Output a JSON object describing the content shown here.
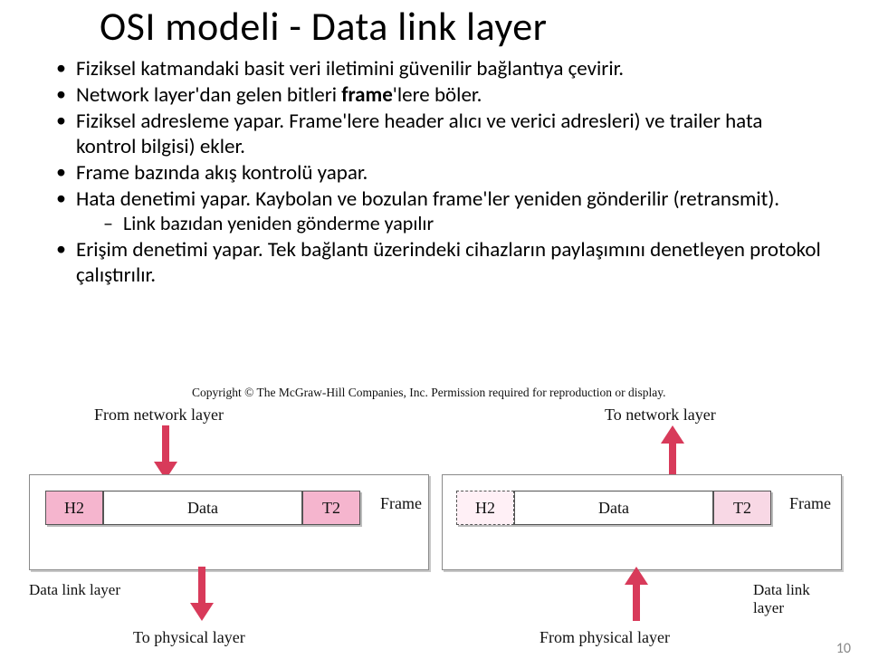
{
  "title": "OSI modeli - Data link layer",
  "bullets": [
    {
      "text": "Fiziksel katmandaki basit veri iletimini güvenilir bağlantıya çevirir."
    },
    {
      "pre": "Network layer'dan gelen bitleri ",
      "bold": "frame",
      "post": "'lere böler."
    },
    {
      "text": "Fiziksel adresleme yapar. Frame'lere header alıcı ve verici adresleri) ve trailer hata kontrol bilgisi) ekler."
    },
    {
      "text": "Frame bazında akış kontrolü yapar."
    },
    {
      "text": "Hata denetimi yapar. Kaybolan ve bozulan frame'ler yeniden gönderilir (retransmit)."
    },
    {
      "sub": "Link bazıdan yeniden gönderme yapılır"
    },
    {
      "text": "Erişim denetimi yapar. Tek bağlantı üzerindeki cihazların paylaşımını denetleyen protokol çalıştırılır."
    }
  ],
  "diagram": {
    "copyright": "Copyright © The McGraw-Hill Companies, Inc. Permission required for reproduction or display.",
    "from_network": "From network layer",
    "to_network": "To network layer",
    "frame_label": "Frame",
    "dll_label": "Data link layer",
    "to_physical": "To physical layer",
    "from_physical": "From physical layer",
    "seg_h2": "H2",
    "seg_data": "Data",
    "seg_t2": "T2"
  },
  "page_number": "10"
}
